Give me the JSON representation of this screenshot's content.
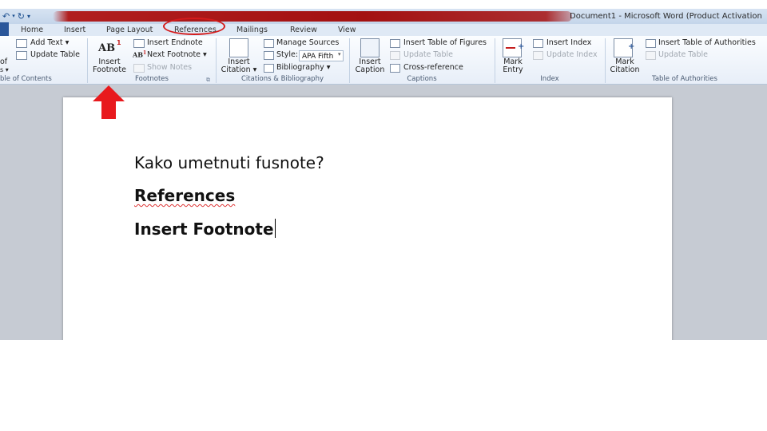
{
  "titlebar": {
    "window_title": "Document1 - Microsoft Word (Product Activation"
  },
  "tabs": [
    "Home",
    "Insert",
    "Page Layout",
    "References",
    "Mailings",
    "Review",
    "View"
  ],
  "ribbon": {
    "toc": {
      "cut_label_1": "of",
      "cut_label_2": "s ▾",
      "add_text": "Add Text ▾",
      "update_table": "Update Table",
      "group": "ble of Contents"
    },
    "footnotes": {
      "insert_footnote_1": "Insert",
      "insert_footnote_2": "Footnote",
      "insert_endnote": "Insert Endnote",
      "next_footnote": "Next Footnote ▾",
      "show_notes": "Show Notes",
      "group": "Footnotes",
      "footnote_icon_text": "AB",
      "footnote_icon_sup": "1",
      "next_icon_text": "AB",
      "next_icon_sup": "1"
    },
    "citations": {
      "insert_citation_1": "Insert",
      "insert_citation_2": "Citation ▾",
      "manage_sources": "Manage Sources",
      "style_label": "Style:",
      "style_value": "APA Fifth",
      "bibliography": "Bibliography ▾",
      "group": "Citations & Bibliography"
    },
    "captions": {
      "insert_caption_1": "Insert",
      "insert_caption_2": "Caption",
      "insert_table_of_figures": "Insert Table of Figures",
      "update_table": "Update Table",
      "cross_reference": "Cross-reference",
      "group": "Captions"
    },
    "index": {
      "mark_entry_1": "Mark",
      "mark_entry_2": "Entry",
      "insert_index": "Insert Index",
      "update_index": "Update Index",
      "group": "Index"
    },
    "authorities": {
      "mark_citation_1": "Mark",
      "mark_citation_2": "Citation",
      "insert_table_of_authorities": "Insert Table of Authorities",
      "update_table": "Update Table",
      "group": "Table of Authorities"
    }
  },
  "document": {
    "line1": "Kako umetnuti fusnote?",
    "line2": "References",
    "line3": "Insert Footnote"
  },
  "colors": {
    "highlight": "#d41b1b",
    "arrow": "#e8191d",
    "accent": "#2b579a"
  }
}
